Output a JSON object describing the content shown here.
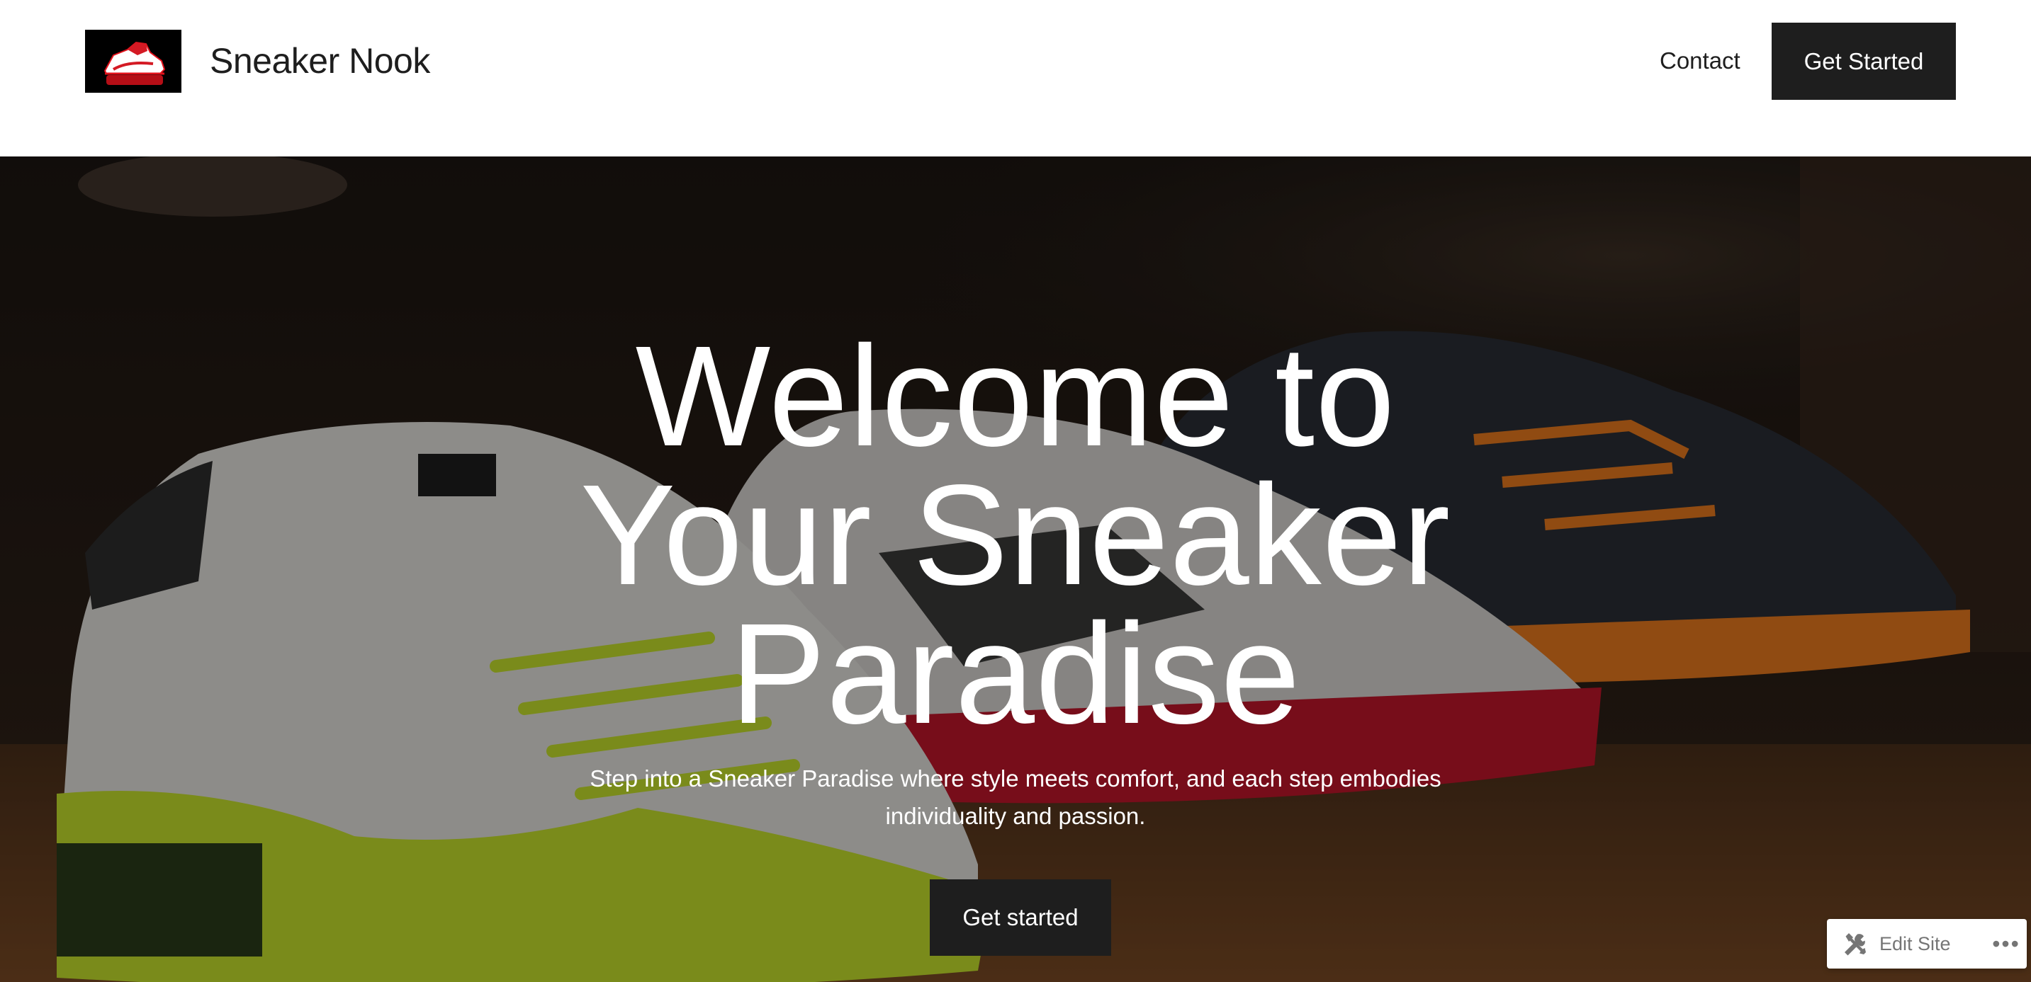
{
  "header": {
    "site_title": "Sneaker Nook",
    "nav": {
      "contact_label": "Contact",
      "cta_label": "Get Started"
    }
  },
  "hero": {
    "heading_lines": [
      "Welcome to",
      "Your Sneaker",
      "Paradise"
    ],
    "subtitle_lines": [
      "Step into a Sneaker Paradise where style meets comfort, and each step embodies",
      "individuality and passion."
    ],
    "cta_label": "Get started"
  },
  "admin_bar": {
    "edit_site_label": "Edit Site",
    "edit_icon": "tools-icon",
    "more_icon": "ellipsis-icon"
  },
  "colors": {
    "button_bg": "#1e1e1e",
    "button_text": "#ffffff",
    "hero_text": "#ffffff",
    "lime_sole": "#c6e02c",
    "red_sole": "#c0152a",
    "orange_sole": "#e87a1e"
  }
}
